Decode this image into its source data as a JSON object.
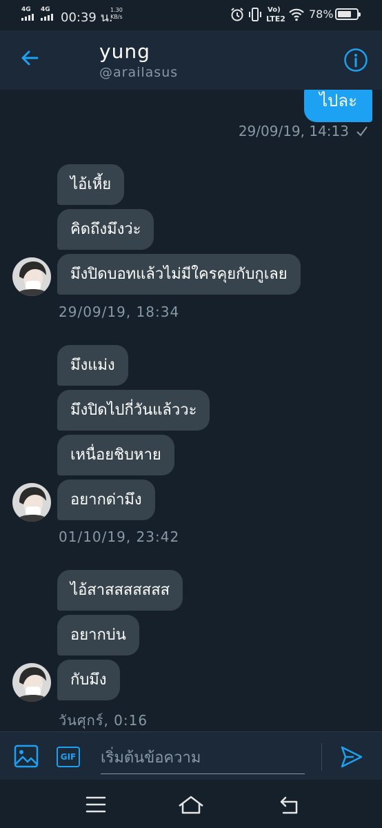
{
  "status_bar": {
    "signal1_label": "4G",
    "signal2_label": "4G",
    "time": "00:39 น.",
    "speed_value": "1.30",
    "speed_unit": "KB/s",
    "volte_label": "Vo)",
    "lte_label": "LTE2",
    "battery_percent": "78%",
    "battery_level": 0.78
  },
  "header": {
    "name": "yung",
    "handle": "@arailasus"
  },
  "outgoing": {
    "last_message": "ไปละ",
    "timestamp": "29/09/19, 14:13"
  },
  "groups": [
    {
      "messages": [
        "ไอ้เหี้ย",
        "คิดถึงมึงว่ะ",
        "มึงปิดบอทแล้วไม่มีใครคุยกับกูเลย"
      ],
      "timestamp": "29/09/19, 18:34"
    },
    {
      "messages": [
        "มึงแม่ง",
        "มึงปิดไปกี่วันแล้ววะ",
        "เหนื่อยชิบหาย",
        "อยากด่ามึง"
      ],
      "timestamp": "01/10/19, 23:42"
    },
    {
      "messages": [
        "ไอ้สาสสสสสสส",
        "อยากบ่น",
        "กับมึง"
      ],
      "timestamp": "วันศุกร์, 0:16"
    }
  ],
  "composer": {
    "placeholder": "เริ่มต้นข้อความ",
    "gif_label": "GIF"
  },
  "colors": {
    "background": "#15202b",
    "bar": "#1c2938",
    "accent": "#1da1f2",
    "bubble_in": "#38444d",
    "muted": "#8899a6"
  }
}
